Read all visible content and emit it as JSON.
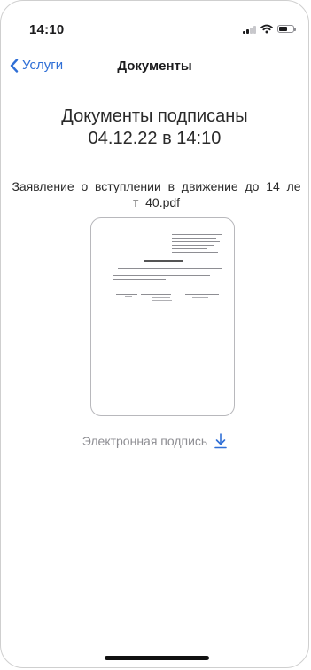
{
  "status_bar": {
    "time": "14:10"
  },
  "nav": {
    "back_label": "Услуги",
    "title": "Документы"
  },
  "main": {
    "signed_line1": "Документы подписаны",
    "signed_line2": "04.12.22 в 14:10",
    "file_name": "Заявление_о_вступлении_в_движение_до_14_лет_40.pdf",
    "signature_label": "Электронная подпись"
  },
  "colors": {
    "accent": "#2f6fd6",
    "secondary_text": "#8e8e93"
  },
  "icons": [
    "chevron-left-icon",
    "signal-icon",
    "wifi-icon",
    "battery-icon",
    "download-icon"
  ]
}
